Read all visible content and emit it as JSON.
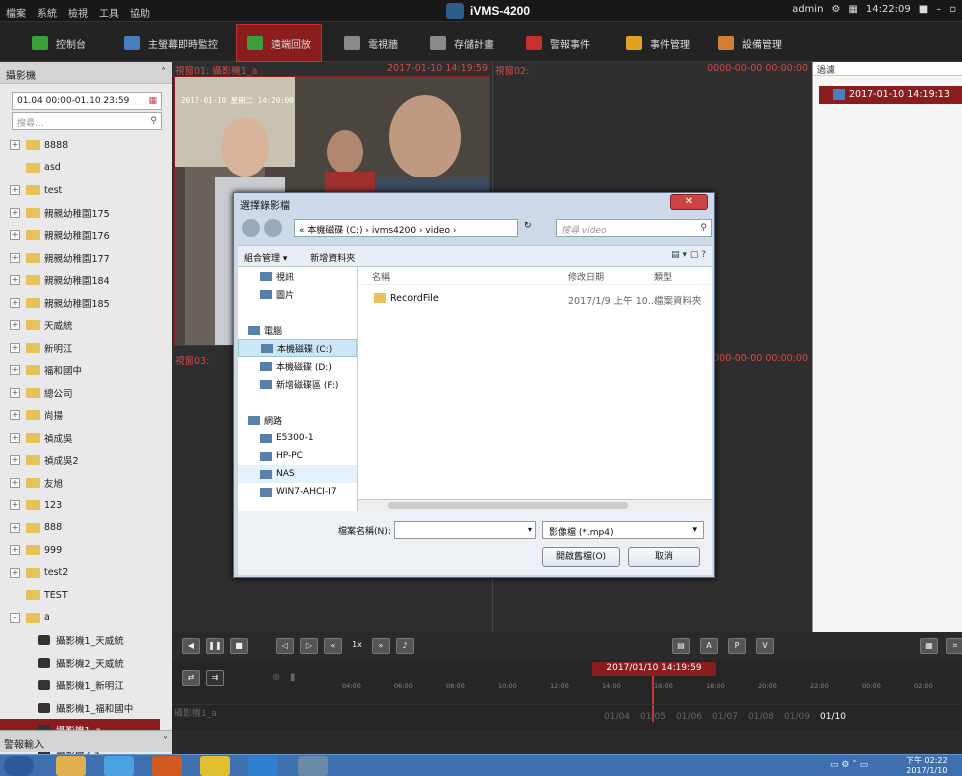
{
  "titlebar": {
    "menu": [
      "檔案",
      "系統",
      "檢視",
      "工具",
      "協助"
    ],
    "app_title": "iVMS-4200",
    "user": "admin",
    "time": "14:22:09"
  },
  "toolbar": {
    "tabs": [
      {
        "label": "控制台",
        "color": "#3b9e3b"
      },
      {
        "label": "主螢幕即時監控",
        "color": "#4a7fbf"
      },
      {
        "label": "遠端回放",
        "color": "#3b9e3b"
      },
      {
        "label": "電視牆",
        "color": "#8a8a8a"
      },
      {
        "label": "存儲計畫",
        "color": "#8a8a8a"
      },
      {
        "label": "警報事件",
        "color": "#c83030"
      },
      {
        "label": "事件管理",
        "color": "#e0a020"
      },
      {
        "label": "設備管理",
        "color": "#d08030"
      }
    ],
    "active_tab": "遠端回放"
  },
  "left_panel": {
    "header": "攝影機",
    "date_range": "01.04 00:00-01.10 23:59",
    "search_placeholder": "搜尋...",
    "tree": [
      {
        "label": "8888",
        "type": "folder",
        "toggle": "+"
      },
      {
        "label": "asd",
        "type": "folder",
        "toggle": ""
      },
      {
        "label": "test",
        "type": "folder",
        "toggle": "+"
      },
      {
        "label": "親親幼稚園175",
        "type": "folder",
        "toggle": "+"
      },
      {
        "label": "親親幼稚園176",
        "type": "folder",
        "toggle": "+"
      },
      {
        "label": "親親幼稚園177",
        "type": "folder",
        "toggle": "+"
      },
      {
        "label": "親親幼稚園184",
        "type": "folder",
        "toggle": "+"
      },
      {
        "label": "親親幼稚園185",
        "type": "folder",
        "toggle": "+"
      },
      {
        "label": "天威統",
        "type": "folder",
        "toggle": "+"
      },
      {
        "label": "新明江",
        "type": "folder",
        "toggle": "+"
      },
      {
        "label": "福和國中",
        "type": "folder",
        "toggle": "+"
      },
      {
        "label": "總公司",
        "type": "folder",
        "toggle": "+"
      },
      {
        "label": "尚揚",
        "type": "folder",
        "toggle": "+"
      },
      {
        "label": "禎成吳",
        "type": "folder",
        "toggle": "+"
      },
      {
        "label": "禎成吳2",
        "type": "folder",
        "toggle": "+"
      },
      {
        "label": "友旭",
        "type": "folder",
        "toggle": "+"
      },
      {
        "label": "123",
        "type": "folder",
        "toggle": "+"
      },
      {
        "label": "888",
        "type": "folder",
        "toggle": "+"
      },
      {
        "label": "999",
        "type": "folder",
        "toggle": "+"
      },
      {
        "label": "test2",
        "type": "folder",
        "toggle": "+"
      },
      {
        "label": "TEST",
        "type": "folder",
        "toggle": ""
      },
      {
        "label": "a",
        "type": "folder",
        "toggle": "-"
      },
      {
        "label": "攝影機1_天威統",
        "type": "camera",
        "toggle": ""
      },
      {
        "label": "攝影機2_天威統",
        "type": "camera",
        "toggle": ""
      },
      {
        "label": "攝影機1_新明江",
        "type": "camera",
        "toggle": ""
      },
      {
        "label": "攝影機1_福和國中",
        "type": "camera",
        "toggle": ""
      },
      {
        "label": "攝影機1_a",
        "type": "camera",
        "toggle": "",
        "selected": true
      },
      {
        "label": "攝影機2 a",
        "type": "camera",
        "toggle": ""
      }
    ],
    "bottom": "警報輸入"
  },
  "video": {
    "win1_label": "視窗01: 攝影機1_a",
    "win1_time": "2017-01-10 14:19:59",
    "win2_label": "視窗02:",
    "win2_time": "0000-00-00 00:00:00",
    "win3_label": "視窗03:",
    "win4_time": "0000-00-00 00:00:00",
    "stamp": "2017-01-10 星期二 14:20:00"
  },
  "right_panel": {
    "filter": "過濾",
    "item": "2017-01-10 14:19:13"
  },
  "controls": {
    "speed": "1x"
  },
  "timeline": {
    "marker": "2017/01/10 14:19:59",
    "ticks": [
      "04:00",
      "06:00",
      "08:00",
      "10:00",
      "12:00",
      "14:00",
      "16:00",
      "18:00",
      "20:00",
      "22:00",
      "00:00",
      "02:00"
    ],
    "track_label": "攝影機1_a",
    "days": [
      "01/04",
      "01/05",
      "01/06",
      "01/07",
      "01/08",
      "01/09",
      "01/10"
    ]
  },
  "dialog": {
    "title": "選擇錄影檔",
    "address": "« 本機磁碟 (C:) › ivms4200 › video ›",
    "search_placeholder": "搜尋 video",
    "organize": "組合管理 ▾",
    "new_folder": "新增資料夾",
    "nav": [
      {
        "label": "視訊",
        "indent": 1
      },
      {
        "label": "圖片",
        "indent": 1
      },
      {
        "label": "",
        "indent": 0
      },
      {
        "label": "電腦",
        "indent": 0
      },
      {
        "label": "本機磁碟 (C:)",
        "indent": 1,
        "selected": true
      },
      {
        "label": "本機磁碟 (D:)",
        "indent": 1
      },
      {
        "label": "新增磁碟區 (F:)",
        "indent": 1
      },
      {
        "label": "",
        "indent": 0
      },
      {
        "label": "網路",
        "indent": 0
      },
      {
        "label": "E5300-1",
        "indent": 1
      },
      {
        "label": "HP-PC",
        "indent": 1
      },
      {
        "label": "NAS",
        "indent": 1,
        "hover": true
      },
      {
        "label": "WIN7-AHCI-I7",
        "indent": 1
      }
    ],
    "columns": [
      "名稱",
      "修改日期",
      "類型"
    ],
    "file": {
      "name": "RecordFile",
      "date": "2017/1/9 上午 10...",
      "type": "檔案資料夾"
    },
    "filename_label": "檔案名稱(N):",
    "filetype": "影像檔 (*.mp4)",
    "open": "開啟舊檔(O)",
    "cancel": "取消"
  },
  "taskbar": {
    "time": "下午 02:22",
    "date": "2017/1/10"
  }
}
